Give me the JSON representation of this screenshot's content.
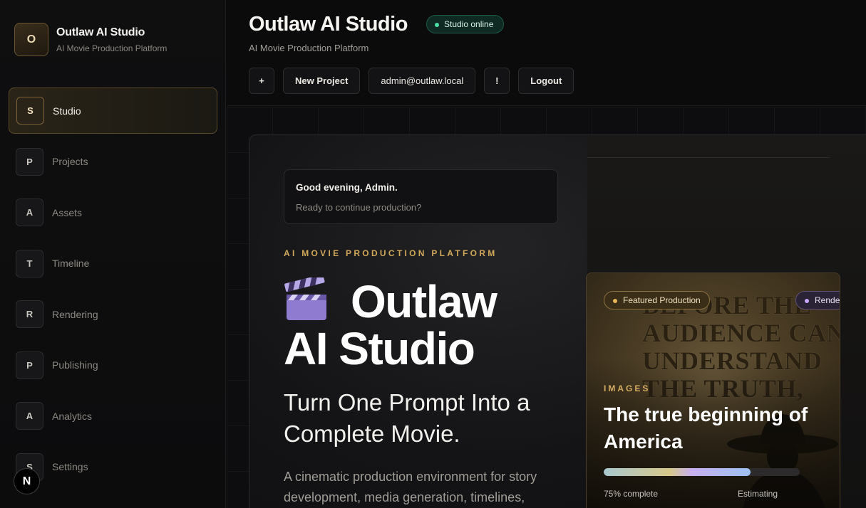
{
  "brand": {
    "badge": "O",
    "title": "Outlaw AI Studio",
    "subtitle": "AI Movie Production Platform"
  },
  "nav": {
    "items": [
      {
        "badge": "S",
        "label": "Studio",
        "active": true
      },
      {
        "badge": "P",
        "label": "Projects",
        "active": false
      },
      {
        "badge": "A",
        "label": "Assets",
        "active": false
      },
      {
        "badge": "T",
        "label": "Timeline",
        "active": false
      },
      {
        "badge": "R",
        "label": "Rendering",
        "active": false
      },
      {
        "badge": "P",
        "label": "Publishing",
        "active": false
      },
      {
        "badge": "A",
        "label": "Analytics",
        "active": false
      },
      {
        "badge": "S",
        "label": "Settings",
        "active": false
      }
    ]
  },
  "floating_badge": "N",
  "header": {
    "title": "Outlaw AI Studio",
    "status": "Studio online",
    "subtitle": "AI Movie Production Platform",
    "toolbar": {
      "plus": "+",
      "new_project": "New Project",
      "email": "admin@outlaw.local",
      "alert": "!",
      "logout": "Logout"
    }
  },
  "hero": {
    "greeting_title": "Good evening, Admin.",
    "greeting_sub": "Ready to continue production?",
    "eyebrow": "AI MOVIE PRODUCTION PLATFORM",
    "title_line1": "Outlaw",
    "title_line2": "AI Studio",
    "tagline": "Turn One Prompt Into a Complete Movie.",
    "description": "A cinematic production environment for story development, media generation, timelines,"
  },
  "featured": {
    "pill": "Featured Production",
    "pill2": "Rende",
    "poster_text": "BEFORE THE\nAUDIENCE CAN\nUNDERSTAND\nTHE TRUTH,",
    "kicker": "IMAGES",
    "title": "The true beginning of America",
    "progress_percent": 75,
    "progress_label": "75% complete",
    "eta_label": "Estimating"
  },
  "colors": {
    "accent_gold": "#d1a85a",
    "status_green": "#4ee0a8",
    "render_purple": "#c9a6ff"
  }
}
